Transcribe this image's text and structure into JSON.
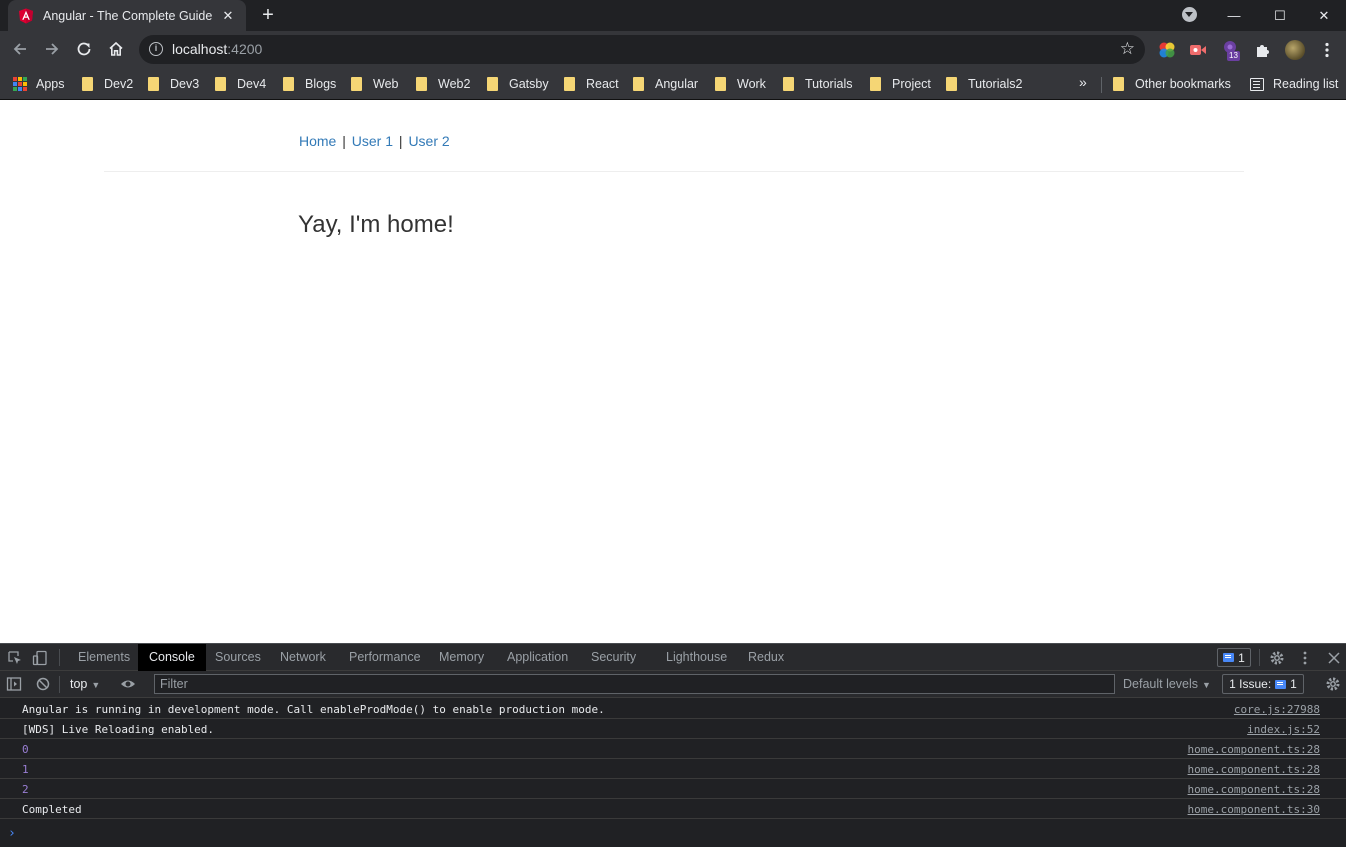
{
  "browser": {
    "tab_title": "Angular - The Complete Guide",
    "tab_close": "✕",
    "new_tab": "+",
    "url_host": "localhost",
    "url_port": ":4200",
    "info_symbol": "i",
    "star_symbol": "☆",
    "extension_badge": "13",
    "window_controls": {
      "minimize": "—",
      "maximize": "☐",
      "close": "✕"
    },
    "icons": [
      "back-arrow-icon",
      "forward-arrow-icon",
      "reload-icon",
      "home-icon",
      "info-icon",
      "bookmark-star-icon",
      "color-picker-extension-icon",
      "video-extension-icon",
      "redux-extension-icon",
      "puzzle-extensions-icon",
      "profile-avatar-icon",
      "kebab-menu-icon"
    ]
  },
  "bookmarks": {
    "items": [
      {
        "label": "Apps",
        "type": "apps"
      },
      {
        "label": "Dev2",
        "type": "folder"
      },
      {
        "label": "Dev3",
        "type": "folder"
      },
      {
        "label": "Dev4",
        "type": "folder"
      },
      {
        "label": "Blogs",
        "type": "folder"
      },
      {
        "label": "Web",
        "type": "folder"
      },
      {
        "label": "Web2",
        "type": "folder"
      },
      {
        "label": "Gatsby",
        "type": "folder"
      },
      {
        "label": "React",
        "type": "folder"
      },
      {
        "label": "Angular",
        "type": "folder"
      },
      {
        "label": "Work",
        "type": "folder"
      },
      {
        "label": "Tutorials",
        "type": "folder"
      },
      {
        "label": "Project",
        "type": "folder"
      },
      {
        "label": "Tutorials2",
        "type": "folder"
      }
    ],
    "overflow": "»",
    "other": "Other bookmarks",
    "reading_list": "Reading list"
  },
  "page": {
    "nav": {
      "home": "Home",
      "user1": "User 1",
      "user2": "User 2",
      "separator": "|"
    },
    "heading": "Yay, I'm home!"
  },
  "devtools": {
    "tabs": [
      "Elements",
      "Console",
      "Sources",
      "Network",
      "Performance",
      "Memory",
      "Application",
      "Security",
      "Lighthouse",
      "Redux"
    ],
    "active_tab": "Console",
    "message_count": "1",
    "context": "top",
    "filter_placeholder": "Filter",
    "levels": "Default levels",
    "issues_label": "1 Issue:",
    "issues_count": "1",
    "logs": [
      {
        "message": "Angular is running in development mode. Call enableProdMode() to enable production mode.",
        "source": "core.js:27988",
        "kind": "text"
      },
      {
        "message": "[WDS] Live Reloading enabled.",
        "source": "index.js:52",
        "kind": "text"
      },
      {
        "message": "0",
        "source": "home.component.ts:28",
        "kind": "number"
      },
      {
        "message": "1",
        "source": "home.component.ts:28",
        "kind": "number"
      },
      {
        "message": "2",
        "source": "home.component.ts:28",
        "kind": "number"
      },
      {
        "message": "Completed",
        "source": "home.component.ts:30",
        "kind": "text"
      }
    ],
    "prompt": "›"
  },
  "colors": {
    "link": "#337ab7",
    "chrome_dark": "#202124",
    "chrome_toolbar": "#35363a",
    "console_number": "#9a7fd5",
    "accent_blue": "#4888f8"
  }
}
